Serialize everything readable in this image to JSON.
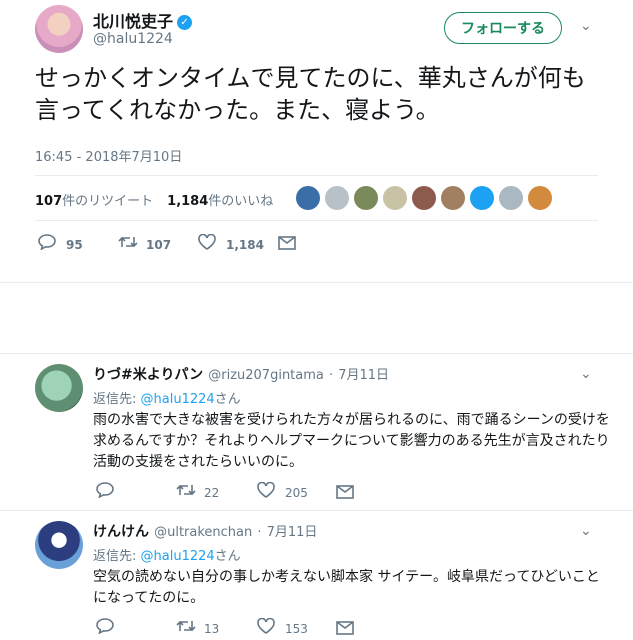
{
  "tweet": {
    "display_name": "北川悦吏子",
    "handle": "@halu1224",
    "follow_label": "フォローする",
    "text": "せっかくオンタイムで見てたのに、華丸さんが何も言ってくれなかった。また、寝よう。",
    "timestamp": "16:45 - 2018年7月10日",
    "retweets_count": "107",
    "retweets_label": "件のリツイート",
    "likes_count": "1,184",
    "likes_label": "件のいいね",
    "reply_count": "95",
    "retweet_count": "107",
    "like_count": "1,184"
  },
  "likers": [
    {
      "color": "#3b6ea8"
    },
    {
      "color": "#b8c0c8"
    },
    {
      "color": "#7a8a5a"
    },
    {
      "color": "#c9c3a5"
    },
    {
      "color": "#8d5a4e"
    },
    {
      "color": "#a08060"
    },
    {
      "color": "#1da1f2"
    },
    {
      "color": "#aab8c2"
    },
    {
      "color": "#d28a3c"
    }
  ],
  "replies": [
    {
      "name": "りづ#米よりパン",
      "handle": "@rizu207gintama",
      "date": "7月11日",
      "reply_to_prefix": "返信先: ",
      "reply_to_handle": "@halu1224",
      "reply_to_suffix": "さん",
      "text": "雨の水害で大きな被害を受けられた方々が居られるのに、雨で踊るシーンの受けを求めるんですか？それよりヘルプマークについて影響力のある先生が言及されたり活動の支援をされたらいいのに。",
      "retweet_count": "22",
      "like_count": "205"
    },
    {
      "name": "けんけん",
      "handle": "@ultrakenchan",
      "date": "7月11日",
      "reply_to_prefix": "返信先: ",
      "reply_to_handle": "@halu1224",
      "reply_to_suffix": "さん",
      "text": "空気の読めない自分の事しか考えない脚本家 サイテー。岐阜県だってひどいことになってたのに。",
      "retweet_count": "13",
      "like_count": "153"
    }
  ],
  "colors": {
    "accent": "#1da1f2",
    "follow": "#1a8a5b",
    "muted": "#657786"
  }
}
